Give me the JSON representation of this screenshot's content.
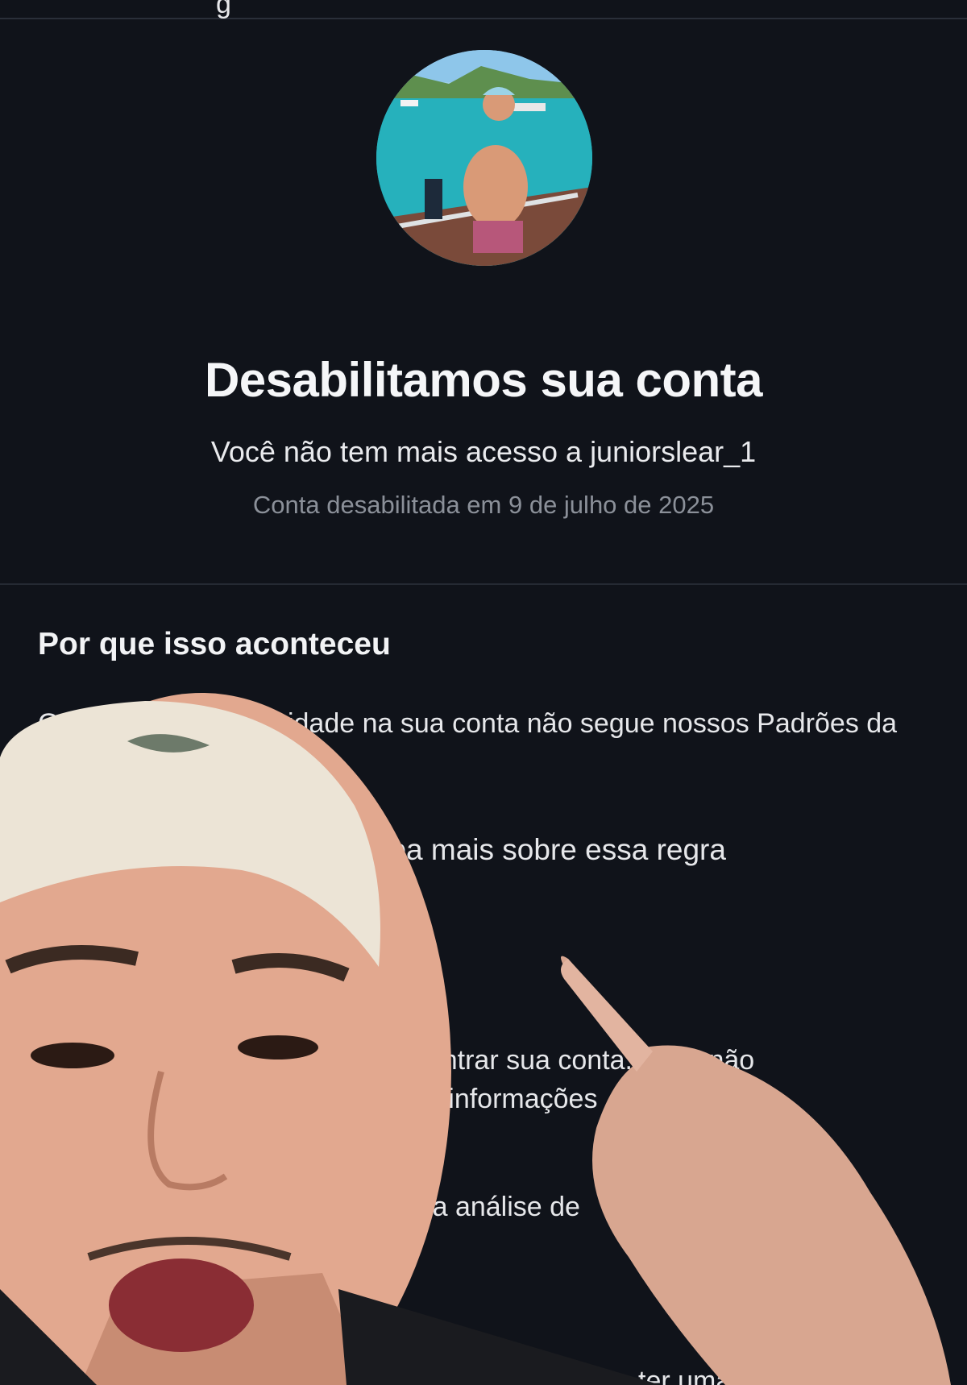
{
  "header": {
    "glyph": "g"
  },
  "profile": {
    "avatar_alt": "profile photo"
  },
  "notice": {
    "title": "Desabilitamos sua conta",
    "subtitle": "Você não tem mais acesso a juniorslear_1",
    "disabled_date": "Conta desabilitada em 9 de julho de 2025"
  },
  "reason": {
    "heading": "Por que isso aconteceu",
    "body": "Grande parte da atividade na sua conta não segue nossos Padrões da Comunidade.",
    "rule_link": "Saiba mais sobre essa regra"
  },
  "info": {
    "find_line1": "encontrar sua conta. Você não",
    "find_line2": "suas informações",
    "review_fragment": "outra análise de",
    "copy_fragment": "ter uma có"
  },
  "overlay": {
    "description": "person in white cap pointing upward"
  }
}
